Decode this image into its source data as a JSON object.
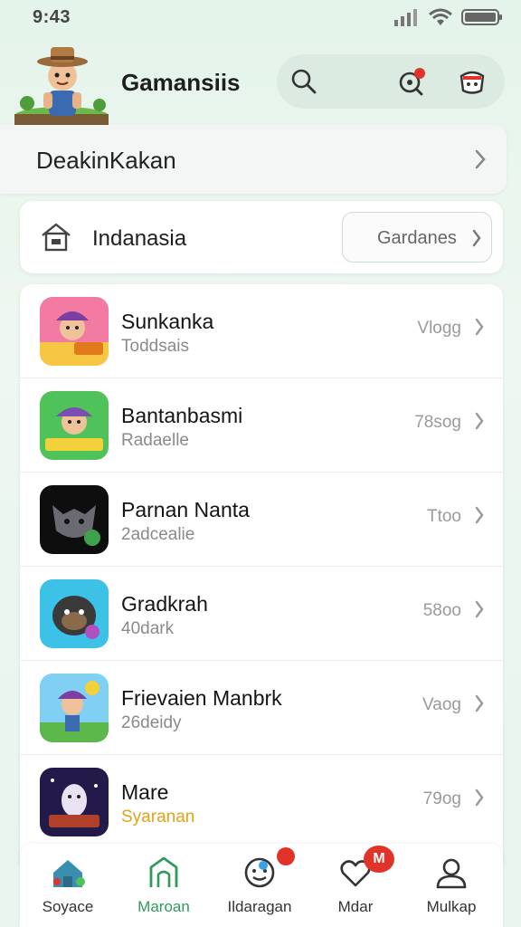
{
  "status_bar": {
    "time": "9:43"
  },
  "header": {
    "title": "Gamansiis",
    "icons": [
      "search-icon",
      "notification-icon",
      "gift-icon"
    ]
  },
  "category": {
    "label": "DeakinKakan"
  },
  "region": {
    "label": "Indanasia",
    "button_label": "Gardanes"
  },
  "games": [
    {
      "name": "Sunkanka",
      "subtitle": "Toddsais",
      "size": "Vlogg"
    },
    {
      "name": "Bantanbasmi",
      "subtitle": "Radaelle",
      "size": "78sog"
    },
    {
      "name": "Parnan Nanta",
      "subtitle": "2adcealie",
      "size": "Ttoo"
    },
    {
      "name": "Gradkrah",
      "subtitle": "40dark",
      "size": "58oo"
    },
    {
      "name": "Frievaien Manbrk",
      "subtitle": "26deidy",
      "size": "Vaog"
    },
    {
      "name": "Mare",
      "subtitle": "Syaranan",
      "size": "79og"
    }
  ],
  "bottom_nav": [
    {
      "label": "Soyace",
      "icon": "home-icon"
    },
    {
      "label": "Maroan",
      "icon": "barn-icon"
    },
    {
      "label": "Ildaragan",
      "icon": "chat-icon"
    },
    {
      "label": "Mdar",
      "icon": "heart-icon",
      "badge": "M"
    },
    {
      "label": "Mulkap",
      "icon": "profile-icon"
    }
  ],
  "colors": {
    "accent": "#2f9a5c",
    "badge": "#e2332b",
    "background": "#e6f4ec"
  }
}
